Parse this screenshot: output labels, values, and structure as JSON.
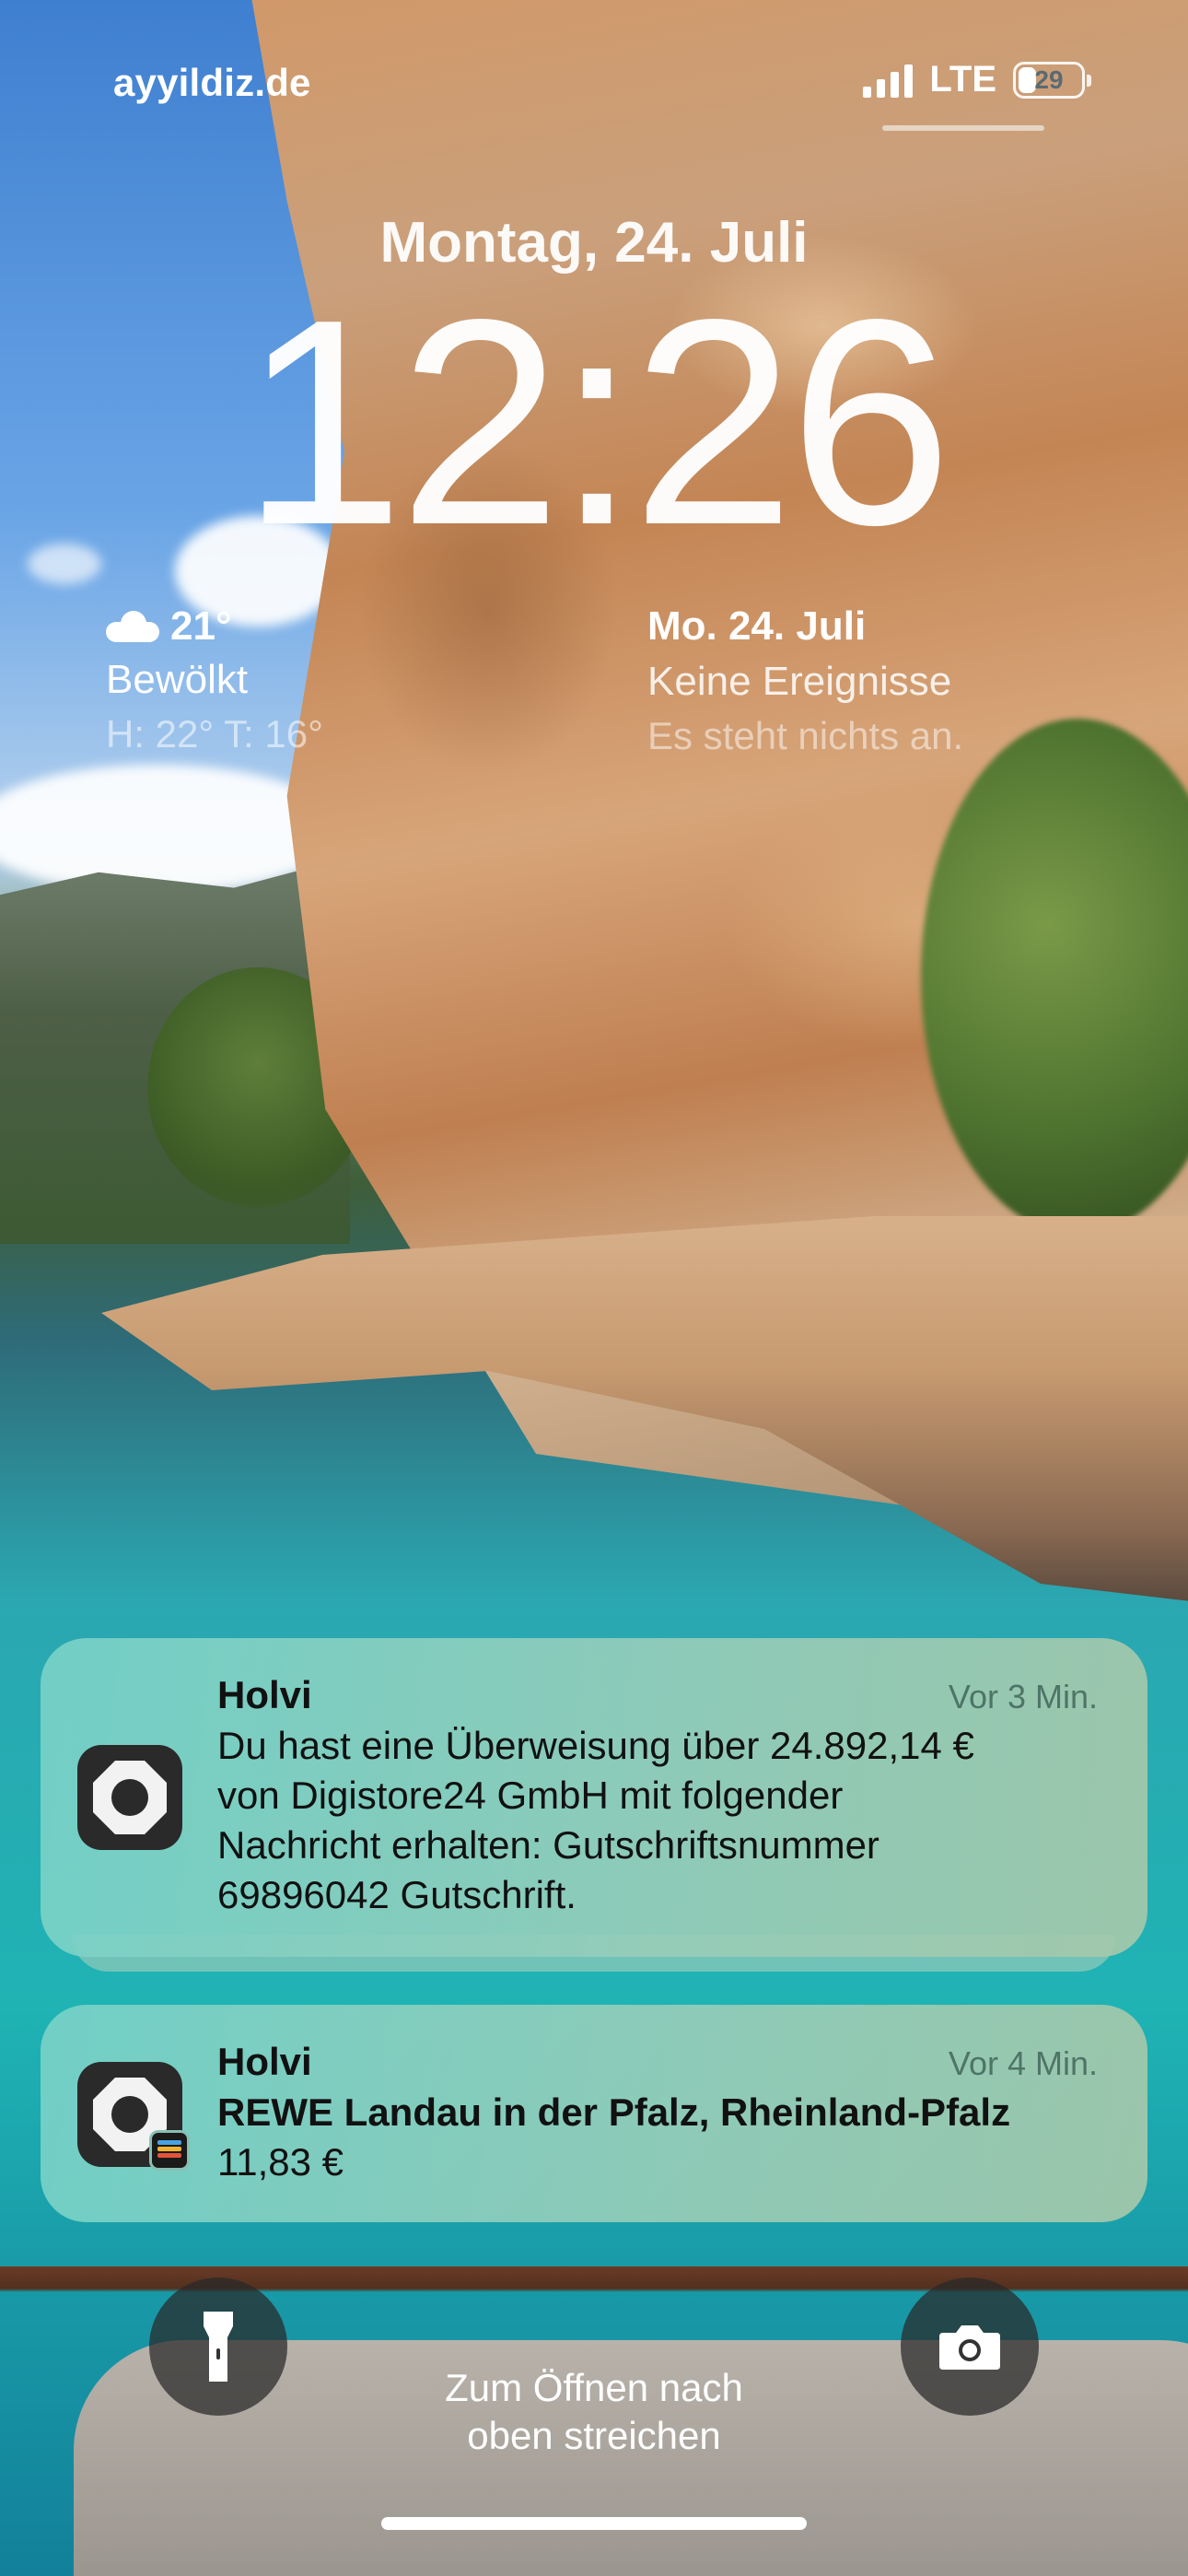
{
  "status_bar": {
    "carrier": "ayyildiz.de",
    "network": "LTE",
    "battery_level": "29",
    "battery_fraction": 0.29,
    "signal_bars": 4
  },
  "lock_screen": {
    "date": "Montag, 24. Juli",
    "time": "12:26",
    "swipe_hint_line1": "Zum Öffnen nach",
    "swipe_hint_line2": "oben streichen"
  },
  "widgets": {
    "weather": {
      "icon": "cloud-icon",
      "temperature": "21°",
      "condition": "Bewölkt",
      "hi_lo": "H: 22° T: 16°"
    },
    "calendar": {
      "date": "Mo. 24. Juli",
      "line1": "Keine Ereignisse",
      "line2": "Es steht nichts an."
    }
  },
  "notifications": [
    {
      "app": "Holvi",
      "time": "Vor 3 Min.",
      "lines": [
        "Du hast eine Überweisung über 24.892,14 €",
        "von Digistore24 GmbH mit folgender",
        "Nachricht erhalten: Gutschriftsnummer",
        "69896042 Gutschrift."
      ]
    },
    {
      "app": "Holvi",
      "time": "Vor 4 Min.",
      "title": "REWE Landau in der Pfalz, Rheinland-Pfalz",
      "amount": "11,83 €"
    }
  ],
  "controls": {
    "flashlight_icon": "flashlight-icon",
    "camera_icon": "camera-icon"
  },
  "colors": {
    "notification_bg": "#8fd3c4",
    "control_bg": "#2a2a2a",
    "text_primary": "#ffffff"
  }
}
